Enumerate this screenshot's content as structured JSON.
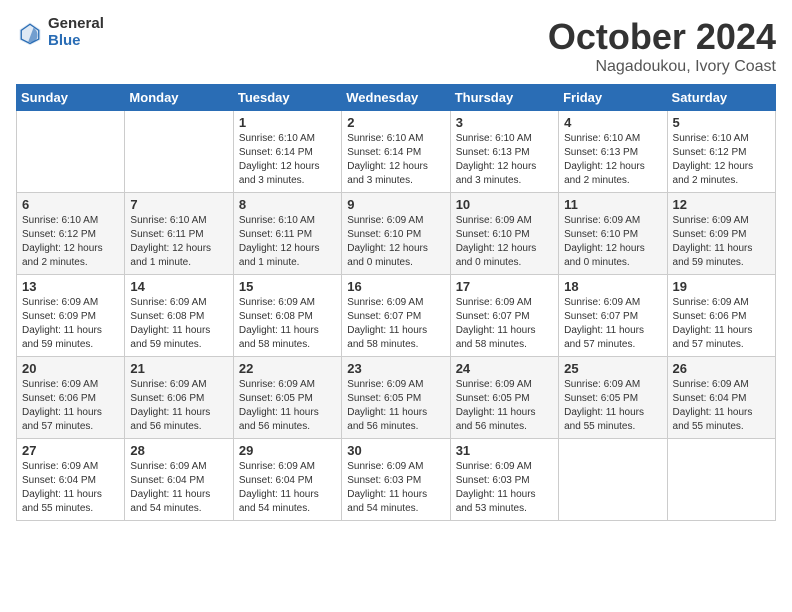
{
  "logo": {
    "general": "General",
    "blue": "Blue"
  },
  "title": {
    "month": "October 2024",
    "location": "Nagadoukou, Ivory Coast"
  },
  "weekdays": [
    "Sunday",
    "Monday",
    "Tuesday",
    "Wednesday",
    "Thursday",
    "Friday",
    "Saturday"
  ],
  "weeks": [
    [
      {
        "day": "",
        "info": ""
      },
      {
        "day": "",
        "info": ""
      },
      {
        "day": "1",
        "info": "Sunrise: 6:10 AM\nSunset: 6:14 PM\nDaylight: 12 hours and 3 minutes."
      },
      {
        "day": "2",
        "info": "Sunrise: 6:10 AM\nSunset: 6:14 PM\nDaylight: 12 hours and 3 minutes."
      },
      {
        "day": "3",
        "info": "Sunrise: 6:10 AM\nSunset: 6:13 PM\nDaylight: 12 hours and 3 minutes."
      },
      {
        "day": "4",
        "info": "Sunrise: 6:10 AM\nSunset: 6:13 PM\nDaylight: 12 hours and 2 minutes."
      },
      {
        "day": "5",
        "info": "Sunrise: 6:10 AM\nSunset: 6:12 PM\nDaylight: 12 hours and 2 minutes."
      }
    ],
    [
      {
        "day": "6",
        "info": "Sunrise: 6:10 AM\nSunset: 6:12 PM\nDaylight: 12 hours and 2 minutes."
      },
      {
        "day": "7",
        "info": "Sunrise: 6:10 AM\nSunset: 6:11 PM\nDaylight: 12 hours and 1 minute."
      },
      {
        "day": "8",
        "info": "Sunrise: 6:10 AM\nSunset: 6:11 PM\nDaylight: 12 hours and 1 minute."
      },
      {
        "day": "9",
        "info": "Sunrise: 6:09 AM\nSunset: 6:10 PM\nDaylight: 12 hours and 0 minutes."
      },
      {
        "day": "10",
        "info": "Sunrise: 6:09 AM\nSunset: 6:10 PM\nDaylight: 12 hours and 0 minutes."
      },
      {
        "day": "11",
        "info": "Sunrise: 6:09 AM\nSunset: 6:10 PM\nDaylight: 12 hours and 0 minutes."
      },
      {
        "day": "12",
        "info": "Sunrise: 6:09 AM\nSunset: 6:09 PM\nDaylight: 11 hours and 59 minutes."
      }
    ],
    [
      {
        "day": "13",
        "info": "Sunrise: 6:09 AM\nSunset: 6:09 PM\nDaylight: 11 hours and 59 minutes."
      },
      {
        "day": "14",
        "info": "Sunrise: 6:09 AM\nSunset: 6:08 PM\nDaylight: 11 hours and 59 minutes."
      },
      {
        "day": "15",
        "info": "Sunrise: 6:09 AM\nSunset: 6:08 PM\nDaylight: 11 hours and 58 minutes."
      },
      {
        "day": "16",
        "info": "Sunrise: 6:09 AM\nSunset: 6:07 PM\nDaylight: 11 hours and 58 minutes."
      },
      {
        "day": "17",
        "info": "Sunrise: 6:09 AM\nSunset: 6:07 PM\nDaylight: 11 hours and 58 minutes."
      },
      {
        "day": "18",
        "info": "Sunrise: 6:09 AM\nSunset: 6:07 PM\nDaylight: 11 hours and 57 minutes."
      },
      {
        "day": "19",
        "info": "Sunrise: 6:09 AM\nSunset: 6:06 PM\nDaylight: 11 hours and 57 minutes."
      }
    ],
    [
      {
        "day": "20",
        "info": "Sunrise: 6:09 AM\nSunset: 6:06 PM\nDaylight: 11 hours and 57 minutes."
      },
      {
        "day": "21",
        "info": "Sunrise: 6:09 AM\nSunset: 6:06 PM\nDaylight: 11 hours and 56 minutes."
      },
      {
        "day": "22",
        "info": "Sunrise: 6:09 AM\nSunset: 6:05 PM\nDaylight: 11 hours and 56 minutes."
      },
      {
        "day": "23",
        "info": "Sunrise: 6:09 AM\nSunset: 6:05 PM\nDaylight: 11 hours and 56 minutes."
      },
      {
        "day": "24",
        "info": "Sunrise: 6:09 AM\nSunset: 6:05 PM\nDaylight: 11 hours and 56 minutes."
      },
      {
        "day": "25",
        "info": "Sunrise: 6:09 AM\nSunset: 6:05 PM\nDaylight: 11 hours and 55 minutes."
      },
      {
        "day": "26",
        "info": "Sunrise: 6:09 AM\nSunset: 6:04 PM\nDaylight: 11 hours and 55 minutes."
      }
    ],
    [
      {
        "day": "27",
        "info": "Sunrise: 6:09 AM\nSunset: 6:04 PM\nDaylight: 11 hours and 55 minutes."
      },
      {
        "day": "28",
        "info": "Sunrise: 6:09 AM\nSunset: 6:04 PM\nDaylight: 11 hours and 54 minutes."
      },
      {
        "day": "29",
        "info": "Sunrise: 6:09 AM\nSunset: 6:04 PM\nDaylight: 11 hours and 54 minutes."
      },
      {
        "day": "30",
        "info": "Sunrise: 6:09 AM\nSunset: 6:03 PM\nDaylight: 11 hours and 54 minutes."
      },
      {
        "day": "31",
        "info": "Sunrise: 6:09 AM\nSunset: 6:03 PM\nDaylight: 11 hours and 53 minutes."
      },
      {
        "day": "",
        "info": ""
      },
      {
        "day": "",
        "info": ""
      }
    ]
  ]
}
